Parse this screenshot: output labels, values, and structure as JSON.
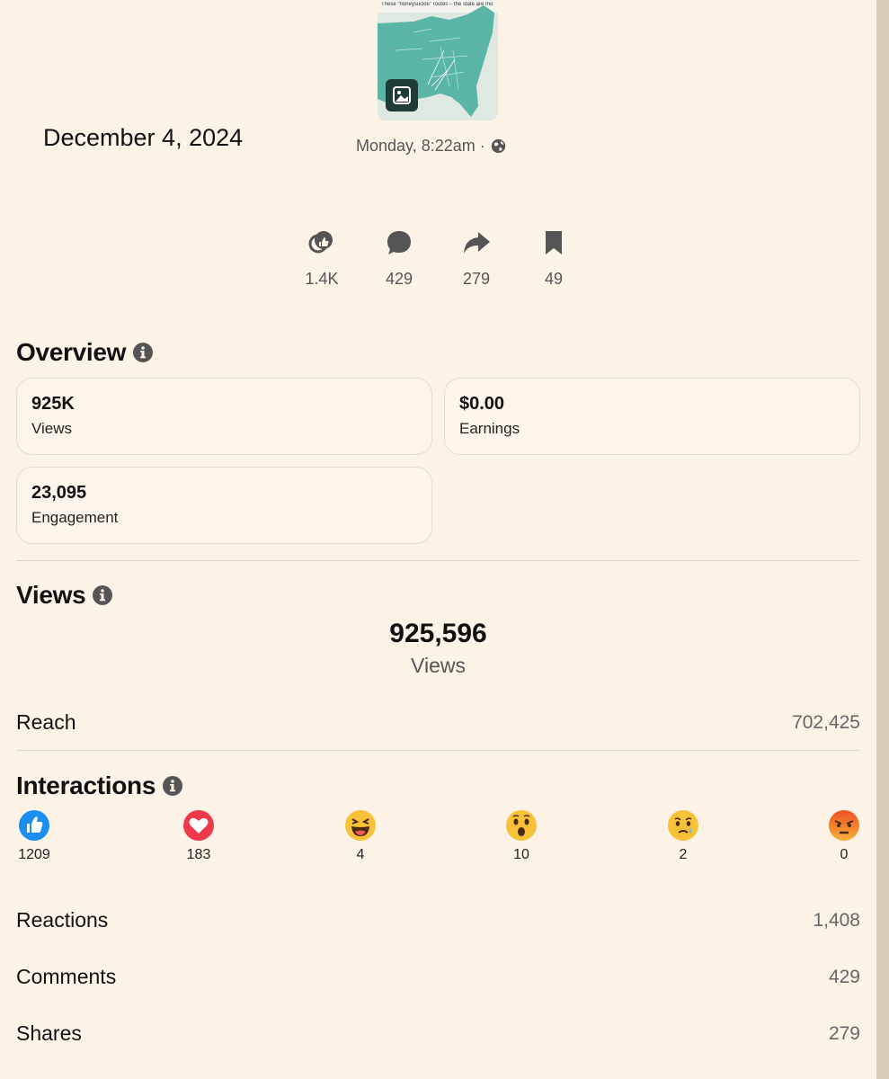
{
  "post": {
    "thumbnail_caption": "These \"honeysuckle\" routes – the state are moving to Alabama's beaches before there",
    "date": "December 4, 2024",
    "timestamp": "Monday, 8:22am ·",
    "visibility_icon": "globe-icon"
  },
  "stats": [
    {
      "icon": "reactions-icon",
      "value": "1.4K"
    },
    {
      "icon": "comment-icon",
      "value": "429"
    },
    {
      "icon": "share-icon",
      "value": "279"
    },
    {
      "icon": "bookmark-icon",
      "value": "49"
    }
  ],
  "overview": {
    "title": "Overview",
    "cards": [
      {
        "value": "925K",
        "label": "Views"
      },
      {
        "value": "$0.00",
        "label": "Earnings"
      },
      {
        "value": "23,095",
        "label": "Engagement"
      }
    ]
  },
  "views": {
    "title": "Views",
    "total": "925,596",
    "total_label": "Views",
    "reach_label": "Reach",
    "reach_value": "702,425"
  },
  "interactions": {
    "title": "Interactions",
    "reactions": [
      {
        "icon": "like-icon",
        "count": "1209"
      },
      {
        "icon": "love-icon",
        "count": "183"
      },
      {
        "icon": "haha-icon",
        "count": "4"
      },
      {
        "icon": "wow-icon",
        "count": "10"
      },
      {
        "icon": "sad-icon",
        "count": "2"
      },
      {
        "icon": "angry-icon",
        "count": "0"
      }
    ],
    "rows": [
      {
        "label": "Reactions",
        "value": "1,408"
      },
      {
        "label": "Comments",
        "value": "429"
      },
      {
        "label": "Shares",
        "value": "279"
      }
    ]
  },
  "colors": {
    "background": "#fcf3e6",
    "card_border": "#e6dccd",
    "icon_gray": "#555555",
    "like_blue": "#1c8ef2",
    "love_red": "#f0384b",
    "emoji_yellow": "#f7c23a",
    "angry_orange": "#ef6a22",
    "map_teal": "#7ec8bc"
  }
}
